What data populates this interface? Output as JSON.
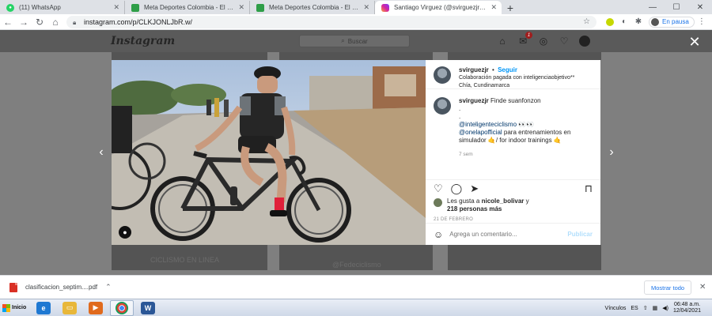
{
  "browser": {
    "tabs": [
      {
        "label": "(11) WhatsApp",
        "favicon": "whatsapp-icon",
        "active": false
      },
      {
        "label": "Meta Deportes Colombia - El Deporte",
        "favicon": "meta-deportes-icon",
        "active": false
      },
      {
        "label": "Meta Deportes Colombia - El Deporte",
        "favicon": "meta-deportes-icon",
        "active": false
      },
      {
        "label": "Santiago Virguez (@svirguezjr) • Fot",
        "favicon": "instagram-icon",
        "active": true
      }
    ],
    "new_tab_symbol": "+",
    "url": "instagram.com/p/CLKJONLJbR.w/",
    "profile_label": "En pausa"
  },
  "instagram": {
    "logo_text": "Instagram",
    "search_placeholder": "Buscar",
    "notification_count": "1",
    "background_captions": [
      "CICLISMO EN LINEA",
      "@Fedeciclismo"
    ]
  },
  "post": {
    "username": "svirguezjr",
    "separator": "•",
    "follow_label": "Seguir",
    "paid_partnership": "Colaboración pagada con inteligenciaobjetivo**",
    "location": "Chía, Cundinamarca",
    "caption": {
      "username": "svirguezjr",
      "text": "Finde suanfonzon",
      "line2": ".",
      "line3": ".",
      "mention1": "@inteligenteciclismo",
      "mention1_suffix": " 👀👀",
      "mention2": "@onelapofficial",
      "mention2_suffix": " para entrenamientos en simulador 🤙/ for indoor trainings 🤙",
      "time_ago": "7 sem"
    },
    "likes": {
      "prefix": "Les gusta a",
      "user": "nicole_bolivar",
      "middle": "y",
      "others": "218 personas más"
    },
    "date": "21 DE FEBRERO",
    "comment_placeholder": "Agrega un comentario...",
    "publish_label": "Publicar"
  },
  "downloads": {
    "filename": "clasificacion_septim....pdf",
    "show_all_label": "Mostrar todo"
  },
  "taskbar": {
    "start_label": "Inicio",
    "tray_label": "Vínculos",
    "language": "ES",
    "time": "06:48 a.m.",
    "date": "12/04/2021"
  }
}
